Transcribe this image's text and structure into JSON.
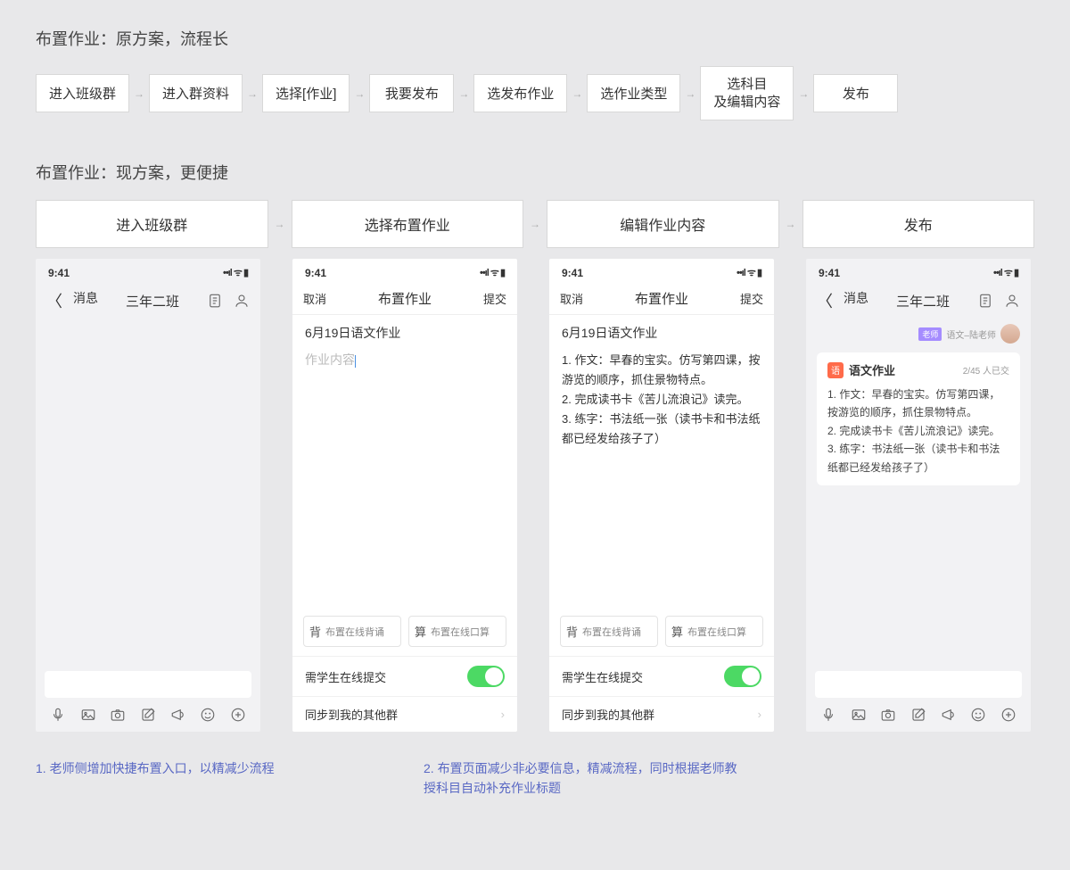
{
  "section1": {
    "title": "布置作业：原方案，流程长"
  },
  "flow_old": [
    "进入班级群",
    "进入群资料",
    "选择[作业]",
    "我要发布",
    "选发布作业",
    "选作业类型",
    "选科目\n及编辑内容",
    "发布"
  ],
  "section2": {
    "title": "布置作业：现方案，更便捷"
  },
  "flow_new": [
    "进入班级群",
    "选择布置作业",
    "编辑作业内容",
    "发布"
  ],
  "status": {
    "time": "9:41",
    "signal": "⋯ıl ᯤ ▮▮"
  },
  "phone1": {
    "back": "消息",
    "title": "三年二班"
  },
  "phone2": {
    "cancel": "取消",
    "title": "布置作业",
    "submit": "提交",
    "assign_title": "6月19日语文作业",
    "placeholder": "作业内容",
    "tag_bei": "背",
    "tag_bei_txt": "布置在线背诵",
    "tag_suan": "算",
    "tag_suan_txt": "布置在线口算",
    "opt1": "需学生在线提交",
    "opt2": "同步到我的其他群"
  },
  "phone3": {
    "cancel": "取消",
    "title": "布置作业",
    "submit": "提交",
    "assign_title": "6月19日语文作业",
    "content": "1. 作文：早春的宝实。仿写第四课，按游览的顺序，抓住景物特点。\n2. 完成读书卡《苦儿流浪记》读完。\n3. 练字：书法纸一张（读书卡和书法纸都已经发给孩子了）"
  },
  "phone4": {
    "back": "消息",
    "title": "三年二班",
    "sender_badge": "老师",
    "sender_name": "语文–陆老师",
    "card_icon": "语",
    "card_title": "语文作业",
    "card_meta": "2/45 人已交",
    "card_body": "1. 作文：早春的宝实。仿写第四课，按游览的顺序，抓住景物特点。\n2. 完成读书卡《苦儿流浪记》读完。\n3. 练字：书法纸一张（读书卡和书法纸都已经发给孩子了）"
  },
  "ann1": "1. 老师侧增加快捷布置入口，以精减少流程",
  "ann2": "2. 布置页面减少非必要信息，精减流程，同时根据老师教授科目自动补充作业标题"
}
